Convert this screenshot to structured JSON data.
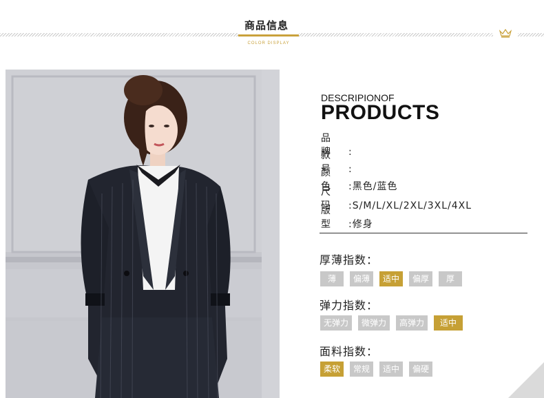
{
  "header": {
    "title": "商品信息",
    "subtitle": "COLOR DISPLAY"
  },
  "colors": {
    "accent": "#c6a035",
    "inactive_tag": "#c8c8c8",
    "text": "#222222"
  },
  "product": {
    "desc_small": "DESCRIPIONOF",
    "desc_big": "PRODUCTS",
    "specs": [
      {
        "label": "品牌",
        "sep": ":",
        "value": ""
      },
      {
        "label": "款号",
        "sep": ":",
        "value": ""
      },
      {
        "label": "颜色",
        "sep": ":",
        "value": "黑色/蓝色"
      },
      {
        "label": "尺码",
        "sep": ":",
        "value": "S/M/L/XL/2XL/3XL/4XL"
      },
      {
        "label": "版型",
        "sep": ":",
        "value": "修身"
      }
    ]
  },
  "indices": [
    {
      "title": "厚薄指数：",
      "tags": [
        "薄",
        "偏薄",
        "适中",
        "偏厚",
        "厚"
      ],
      "selected": 2
    },
    {
      "title": "弹力指数：",
      "tags": [
        "无弹力",
        "微弹力",
        "高弹力",
        "适中"
      ],
      "selected": 3
    },
    {
      "title": "面料指数：",
      "tags": [
        "柔软",
        "常规",
        "适中",
        "偏硬"
      ],
      "selected": 0
    }
  ],
  "icons": {
    "crown": "crown-icon"
  }
}
